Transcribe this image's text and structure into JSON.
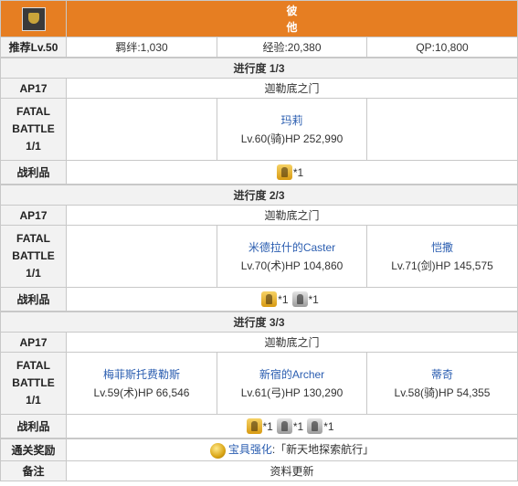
{
  "header": {
    "icon": "quest-icon",
    "title_line1": "彼",
    "title_line2": "他"
  },
  "rec_row": {
    "label": "推荐Lv.50",
    "bond": "羁绊:1,030",
    "exp": "经验:20,380",
    "qp": "QP:10,800"
  },
  "stages": [
    {
      "progress": "进行度 1/3",
      "ap": "AP17",
      "location": "迦勒底之门",
      "fatal_l1": "FATAL",
      "fatal_l2": "BATTLE",
      "fatal_l3": "1/1",
      "enemies": [
        {
          "name": "",
          "stats": ""
        },
        {
          "name": "玛莉",
          "stats": "Lv.60(骑)HP 252,990"
        },
        {
          "name": "",
          "stats": ""
        }
      ],
      "spoils_label": "战利品",
      "drops": [
        {
          "count": "*1",
          "tier": "gold"
        }
      ]
    },
    {
      "progress": "进行度 2/3",
      "ap": "AP17",
      "location": "迦勒底之门",
      "fatal_l1": "FATAL",
      "fatal_l2": "BATTLE",
      "fatal_l3": "1/1",
      "enemies": [
        {
          "name": "",
          "stats": ""
        },
        {
          "name": "米德拉什的Caster",
          "stats": "Lv.70(术)HP 104,860"
        },
        {
          "name": "恺撒",
          "stats": "Lv.71(剑)HP 145,575"
        }
      ],
      "spoils_label": "战利品",
      "drops": [
        {
          "count": "*1",
          "tier": "gold"
        },
        {
          "count": "*1",
          "tier": "silver"
        }
      ]
    },
    {
      "progress": "进行度 3/3",
      "ap": "AP17",
      "location": "迦勒底之门",
      "fatal_l1": "FATAL",
      "fatal_l2": "BATTLE",
      "fatal_l3": "1/1",
      "enemies": [
        {
          "name": "梅菲斯托费勒斯",
          "stats": "Lv.59(术)HP 66,546"
        },
        {
          "name": "新宿的Archer",
          "stats": "Lv.61(弓)HP 130,290"
        },
        {
          "name": "蒂奇",
          "stats": "Lv.58(骑)HP 54,355"
        }
      ],
      "spoils_label": "战利品",
      "drops": [
        {
          "count": "*1",
          "tier": "gold"
        },
        {
          "count": "*1",
          "tier": "silver"
        },
        {
          "count": "*1",
          "tier": "silver"
        }
      ]
    }
  ],
  "reward": {
    "label": "通关奖励",
    "link": "宝具强化",
    "text": ":「新天地探索航行」"
  },
  "notes": {
    "label": "备注",
    "text": "资料更新"
  },
  "colors": {
    "header_bg": "#e67e22",
    "label_bg": "#f2f2f2",
    "link": "#2a5db0",
    "border": "#c8c8c8"
  }
}
